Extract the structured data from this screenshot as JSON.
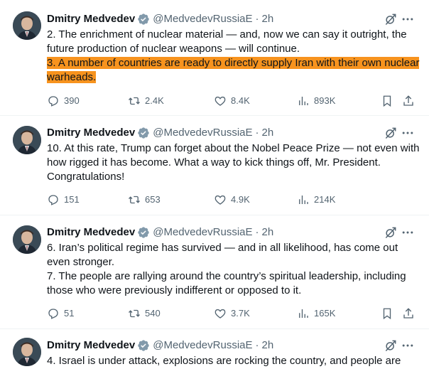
{
  "tweets": [
    {
      "name": "Dmitry Medvedev",
      "handle": "@MedvedevRussiaE",
      "separator": "·",
      "time": "2h",
      "paragraphs": [
        "2. The enrichment of nuclear material — and, now we can say it outright, the future production of nuclear weapons — will continue."
      ],
      "highlight": "3. A number of countries are ready to directly supply Iran with their own nuclear warheads.",
      "stats": {
        "replies": "390",
        "reposts": "2.4K",
        "likes": "8.4K",
        "views": "893K"
      }
    },
    {
      "name": "Dmitry Medvedev",
      "handle": "@MedvedevRussiaE",
      "separator": "·",
      "time": "2h",
      "paragraphs": [
        "10. At this rate, Trump can forget about the Nobel Peace Prize — not even with how rigged it has become. What a way to kick things off, Mr. President. Congratulations!"
      ],
      "stats": {
        "replies": "151",
        "reposts": "653",
        "likes": "4.9K",
        "views": "214K"
      }
    },
    {
      "name": "Dmitry Medvedev",
      "handle": "@MedvedevRussiaE",
      "separator": "·",
      "time": "2h",
      "paragraphs": [
        "6. Iran’s political regime has survived — and in all likelihood, has come out even stronger.",
        "7. The people are rallying around the country’s spiritual leadership, including those who were previously indifferent or opposed to it."
      ],
      "stats": {
        "replies": "51",
        "reposts": "540",
        "likes": "3.7K",
        "views": "165K"
      }
    },
    {
      "name": "Dmitry Medvedev",
      "handle": "@MedvedevRussiaE",
      "separator": "·",
      "time": "2h",
      "paragraphs": [
        "4. Israel is under attack, explosions are rocking the country, and people are"
      ]
    }
  ],
  "icons": {
    "verified": "verified-badge-icon",
    "grok": "grok-icon",
    "more": "more-icon",
    "reply": "reply-icon",
    "repost": "repost-icon",
    "like": "heart-icon",
    "views": "views-icon",
    "bookmark": "bookmark-icon",
    "share": "share-icon"
  },
  "colors": {
    "text": "#0f1419",
    "muted": "#536471",
    "verified": "#1d9bf0",
    "highlight": "#f7931e",
    "divider": "#eff3f4"
  }
}
